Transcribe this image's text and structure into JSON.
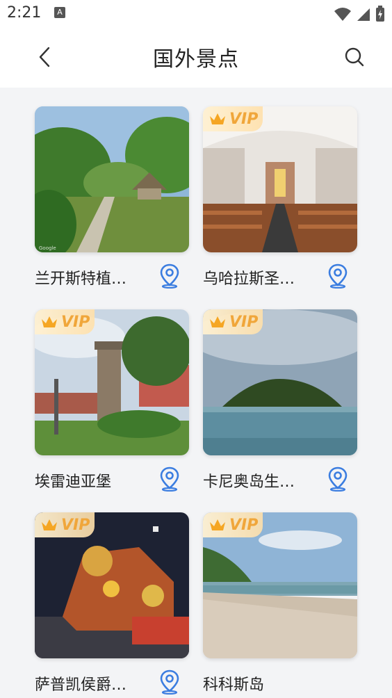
{
  "status": {
    "time": "2:21",
    "notification_letter": "A"
  },
  "header": {
    "title": "国外景点"
  },
  "spots": [
    {
      "name": "兰开斯特植…",
      "vip": false,
      "image": "garden"
    },
    {
      "name": "乌哈拉斯圣…",
      "vip": true,
      "image": "church"
    },
    {
      "name": "埃雷迪亚堡",
      "vip": true,
      "image": "tower"
    },
    {
      "name": "卡尼奥岛生…",
      "vip": true,
      "image": "island"
    },
    {
      "name": "萨普凯侯爵…",
      "vip": true,
      "image": "carnival"
    },
    {
      "name": "科科斯岛",
      "vip": true,
      "image": "beach"
    }
  ],
  "vip_label": "VIP",
  "google_mark": "Google",
  "colors": {
    "accent": "#3b7de0",
    "vip": "#f0a63a"
  },
  "icons": {
    "back": "chevron-left-icon",
    "search": "search-icon",
    "location": "location-pin-icon",
    "vip": "crown-icon"
  }
}
